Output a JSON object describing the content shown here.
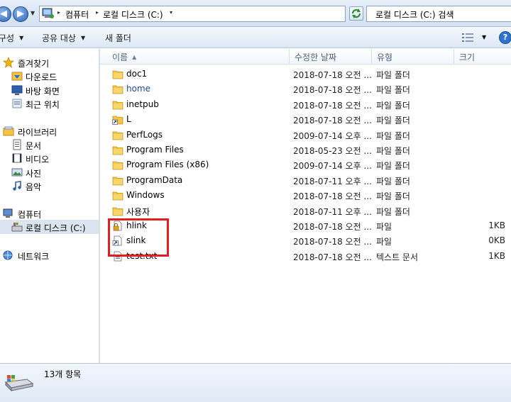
{
  "colors": {
    "accent": "#2c63b5",
    "highlight": "#e02020",
    "folder": "#f4c443"
  },
  "address_bar": {
    "crumbs": [
      "컴퓨터",
      "로컬 디스크 (C:)"
    ],
    "search_placeholder": "로컬 디스크 (C:) 검색"
  },
  "command_bar": {
    "organize": "구성",
    "share_with": "공유 대상",
    "new_folder": "새 폴더"
  },
  "nav": {
    "favorites": {
      "label": "즐겨찾기",
      "icon": "star-icon"
    },
    "favorites_items": [
      {
        "label": "다운로드",
        "icon": "downloads-folder-icon"
      },
      {
        "label": "바탕 화면",
        "icon": "desktop-icon"
      },
      {
        "label": "최근 위치",
        "icon": "recent-places-icon"
      }
    ],
    "libraries": {
      "label": "라이브러리",
      "icon": "library-icon"
    },
    "libraries_items": [
      {
        "label": "문서",
        "icon": "documents-icon"
      },
      {
        "label": "비디오",
        "icon": "videos-icon"
      },
      {
        "label": "사진",
        "icon": "pictures-icon"
      },
      {
        "label": "음악",
        "icon": "music-icon"
      }
    ],
    "computer": {
      "label": "컴퓨터",
      "icon": "computer-icon"
    },
    "local_disk": {
      "label": "로컬 디스크 (C:)",
      "icon": "drive-icon"
    },
    "network": {
      "label": "네트워크",
      "icon": "network-icon"
    }
  },
  "columns": {
    "name": "이름",
    "date": "수정한 날짜",
    "type": "유형",
    "size": "크기"
  },
  "files": [
    {
      "name": "doc1",
      "date": "2018-07-18 오전 ...",
      "type": "파일 폴더",
      "size": "",
      "icon": "folder-icon"
    },
    {
      "name": "home",
      "date": "2018-07-18 오전 ...",
      "type": "파일 폴더",
      "size": "",
      "icon": "folder-icon"
    },
    {
      "name": "inetpub",
      "date": "2018-07-18 오전 ...",
      "type": "파일 폴더",
      "size": "",
      "icon": "folder-icon"
    },
    {
      "name": "L",
      "date": "2018-07-18 오전 ...",
      "type": "파일 폴더",
      "size": "",
      "icon": "folder-shortcut-icon"
    },
    {
      "name": "PerfLogs",
      "date": "2009-07-14 오후 ...",
      "type": "파일 폴더",
      "size": "",
      "icon": "folder-icon"
    },
    {
      "name": "Program Files",
      "date": "2018-05-23 오전 ...",
      "type": "파일 폴더",
      "size": "",
      "icon": "folder-icon"
    },
    {
      "name": "Program Files (x86)",
      "date": "2009-07-14 오후 ...",
      "type": "파일 폴더",
      "size": "",
      "icon": "folder-icon"
    },
    {
      "name": "ProgramData",
      "date": "2018-07-11 오후 ...",
      "type": "파일 폴더",
      "size": "",
      "icon": "folder-icon"
    },
    {
      "name": "Windows",
      "date": "2018-07-18 오전 ...",
      "type": "파일 폴더",
      "size": "",
      "icon": "folder-icon"
    },
    {
      "name": "사용자",
      "date": "2018-07-11 오후 ...",
      "type": "파일 폴더",
      "size": "",
      "icon": "folder-icon"
    },
    {
      "name": "hlink",
      "date": "2018-07-18 오전 ...",
      "type": "파일",
      "size": "1KB",
      "icon": "locked-file-icon"
    },
    {
      "name": "slink",
      "date": "2018-07-18 오전 ...",
      "type": "파일",
      "size": "0KB",
      "icon": "shortcut-file-icon"
    },
    {
      "name": "test.txt",
      "date": "2018-07-18 오전 ...",
      "type": "텍스트 문서",
      "size": "1KB",
      "icon": "text-file-icon"
    }
  ],
  "details": {
    "item_count": "13개 항목",
    "icon": "drive-icon"
  }
}
